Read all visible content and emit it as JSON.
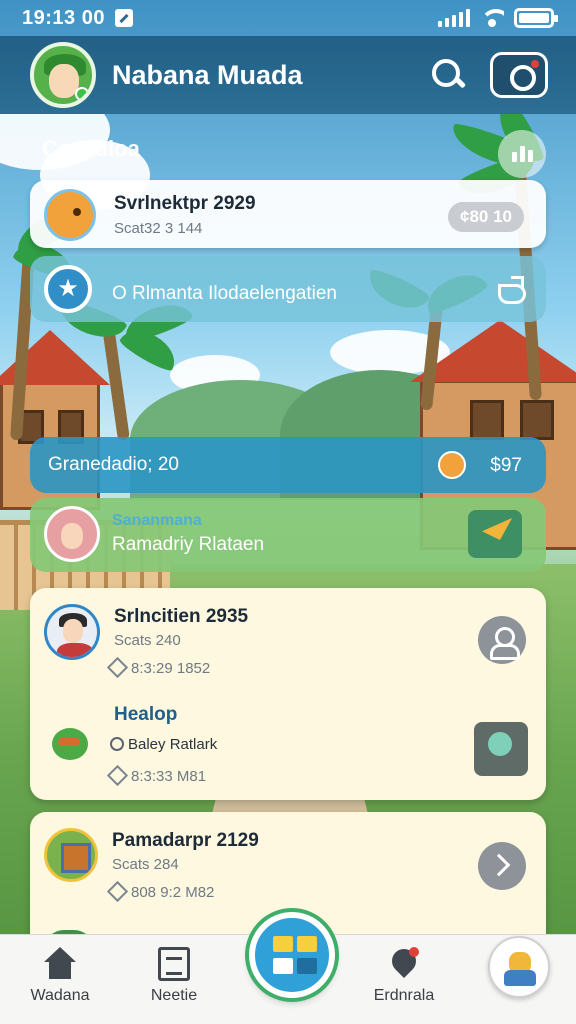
{
  "status_bar": {
    "time": "19:13 00"
  },
  "header": {
    "title": "Nabana Muada"
  },
  "section": {
    "title": "Casualoa"
  },
  "cards": [
    {
      "title": "Svrlnektpr 2929",
      "subtitle": "Scat32 3 144",
      "badge": "¢80 10"
    },
    {
      "title": "O Rlmanta Ilodaelengatien"
    },
    {
      "title": "Granedadio; 20",
      "value": "$97"
    },
    {
      "label": "Sananmana",
      "title": "Ramadriy Rlataen"
    }
  ],
  "list_card_1": [
    {
      "title": "Srlncitien 2935",
      "subtitle": "Scats 240",
      "meta": "8:3:29 1852"
    },
    {
      "title": "Healop",
      "subtitle": "Baley Ratlark",
      "meta": "8:3:33 M81"
    }
  ],
  "list_card_2": [
    {
      "title": "Pamadarpr 2129",
      "subtitle": "Scats 284",
      "meta": "808 9:2 M82"
    }
  ],
  "bottom_nav": {
    "items": [
      {
        "label": "Wadana"
      },
      {
        "label": "Neetie"
      },
      {
        "label": "Erdnrala"
      }
    ]
  }
}
